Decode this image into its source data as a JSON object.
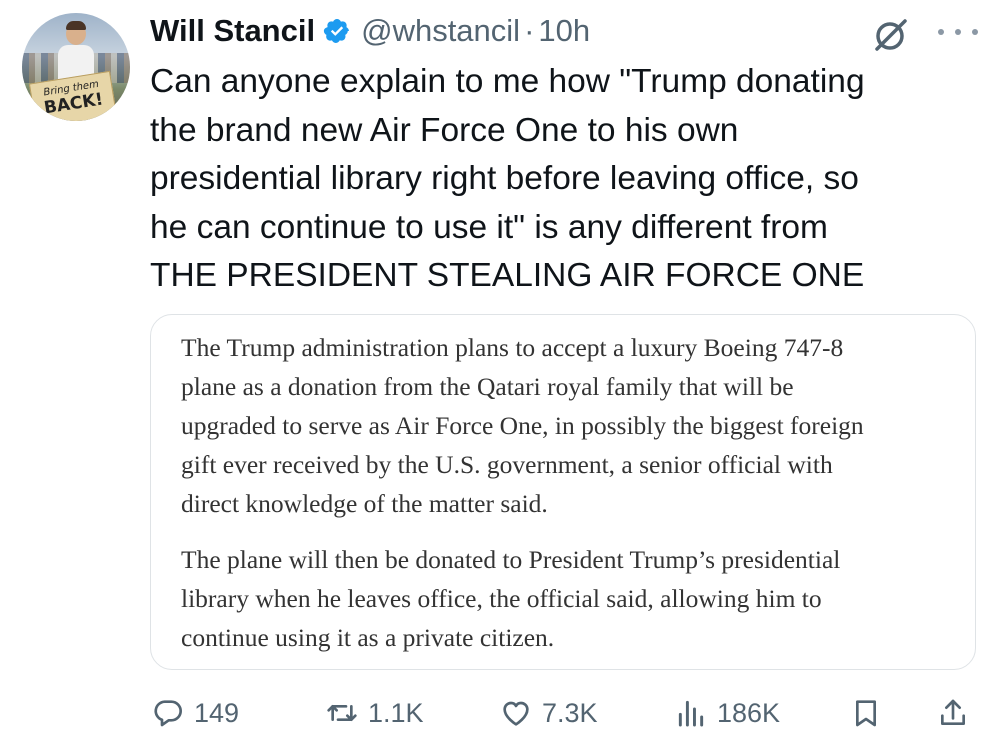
{
  "author": {
    "name": "Will Stancil",
    "handle": "@whstancil",
    "separator": "·",
    "time": "10h",
    "avatar_sign_line1": "Bring them",
    "avatar_sign_line2": "BACK!"
  },
  "tweet": {
    "lines": [
      "Can anyone explain to me how \"Trump donating",
      "the brand new Air Force One to his own",
      "presidential library right before leaving office, so",
      "he can continue to use it\" is any different from",
      "THE PRESIDENT STEALING AIR FORCE ONE"
    ]
  },
  "quote": {
    "paragraph1": [
      "The Trump administration plans to accept a luxury Boeing 747-8",
      "plane as a donation from the Qatari royal family that will be",
      "upgraded to serve as Air Force One, in possibly the biggest foreign",
      "gift ever received by the U.S. government, a senior official with",
      "direct knowledge of the matter said."
    ],
    "paragraph2": [
      "The plane will then be donated to President Trump’s presidential",
      "library when he leaves office, the official said, allowing him to",
      "continue using it as a private citizen."
    ]
  },
  "actions": {
    "replies": "149",
    "reposts": "1.1K",
    "likes": "7.3K",
    "views": "186K"
  },
  "icons": {
    "verified": "verified-badge-icon",
    "grok": "grok-icon",
    "more": "more-icon",
    "reply": "reply-icon",
    "repost": "repost-icon",
    "like": "heart-icon",
    "views": "views-icon",
    "bookmark": "bookmark-icon",
    "share": "share-icon"
  },
  "colors": {
    "text": "#0f1419",
    "secondary": "#536471",
    "verified": "#1d9bf0",
    "border": "#dfe3e6"
  }
}
